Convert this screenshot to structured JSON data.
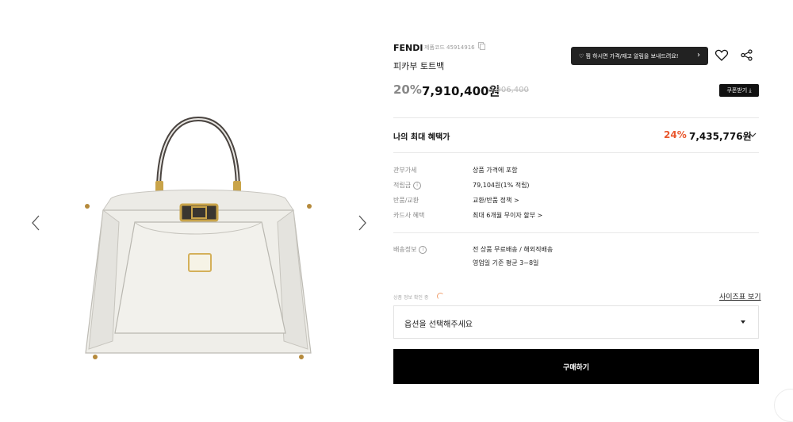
{
  "gallery": {
    "prev_label": "‹",
    "next_label": "›"
  },
  "product": {
    "brand": "FENDI",
    "code_label": "제품코드 45914916",
    "name": "피카부 토트백",
    "discount": "20%",
    "sale_price": "7,910,400원",
    "original_price": "9,906,400"
  },
  "actions": {
    "restock_tooltip": "♡ 찜 하시면 가격/재고 알림을 보내드려요!",
    "coupon_label": "쿠폰받기 ⤓",
    "heart_icon": "heart-icon",
    "share_icon": "share-icon"
  },
  "benefit": {
    "label": "나의 최대 혜택가",
    "percent": "24%",
    "price": "7,435,776원"
  },
  "info_rows": [
    {
      "label": "관부가세",
      "value": "상품 가격에 포함"
    },
    {
      "label": "적립금",
      "value": "79,104원(1% 적립)"
    },
    {
      "label": "반품/교환",
      "value": "교환/반품 정책 >"
    },
    {
      "label": "카드사 혜택",
      "value": "최대 6개월 무이자 할부 >"
    }
  ],
  "shipping": {
    "label": "배송정보",
    "line1": "전 상품 무료배송 / 해외직배송",
    "line2": "영업일 기준 평균 3~8일"
  },
  "options": {
    "loading_label": "상품 정보 확인 중",
    "size_guide": "사이즈표 보기",
    "placeholder": "옵션을 선택해주세요"
  },
  "buy_label": "구매하기",
  "colors": {
    "accent": "#e9582e",
    "button": "#000000",
    "tooltip": "#222222"
  }
}
